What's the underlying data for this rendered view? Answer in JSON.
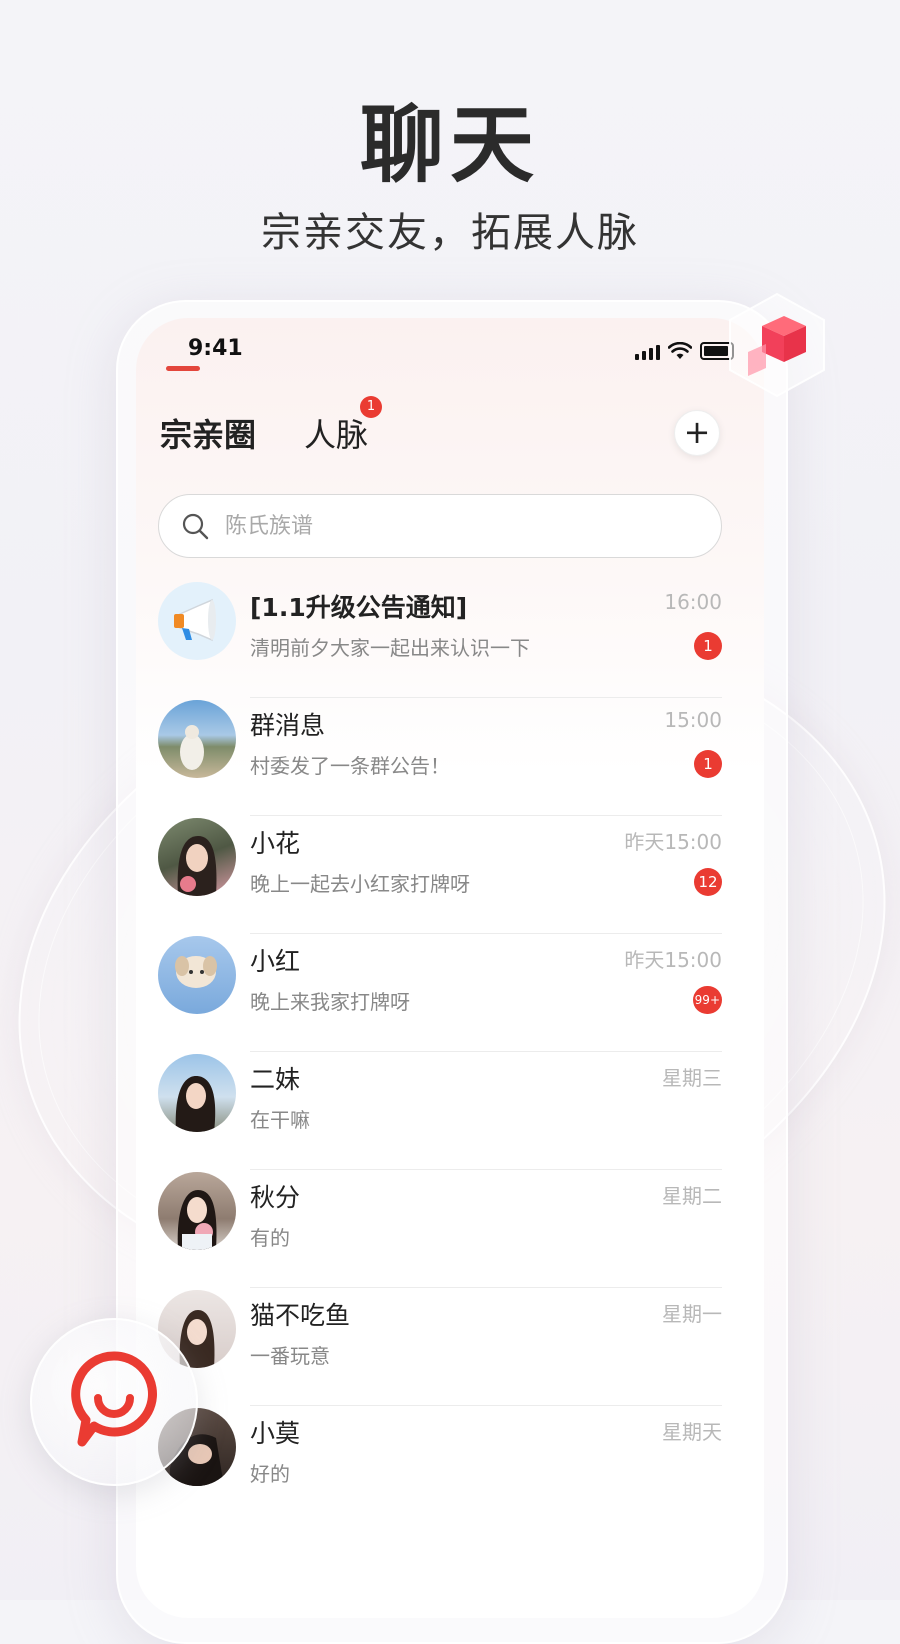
{
  "hero": {
    "title": "聊天",
    "subtitle": "宗亲交友，拓展人脉"
  },
  "status_bar": {
    "time": "9:41"
  },
  "tabs": [
    {
      "label": "宗亲圈",
      "active": true
    },
    {
      "label": "人脉",
      "badge": "1"
    }
  ],
  "add_button": "+",
  "search": {
    "placeholder": "陈氏族谱"
  },
  "chats": [
    {
      "name": "[1.1升级公告通知]",
      "message": "清明前夕大家一起出来认识一下",
      "time": "16:00",
      "unread": "1",
      "avatar": "megaphone-icon"
    },
    {
      "name": "群消息",
      "message": "村委发了一条群公告！",
      "time": "15:00",
      "unread": "1",
      "avatar": "landscape-avatar"
    },
    {
      "name": "小花",
      "message": "晚上一起去小红家打牌呀",
      "time": "昨天15:00",
      "unread": "12",
      "avatar": "woman-avatar"
    },
    {
      "name": "小红",
      "message": "晚上来我家打牌呀",
      "time": "昨天15:00",
      "unread": "99+",
      "avatar": "dog-avatar"
    },
    {
      "name": "二妹",
      "message": "在干嘛",
      "time": "星期三",
      "avatar": "woman-avatar"
    },
    {
      "name": "秋分",
      "message": "有的",
      "time": "星期二",
      "avatar": "woman-flowers-avatar"
    },
    {
      "name": "猫不吃鱼",
      "message": "一番玩意",
      "time": "星期一",
      "avatar": "woman-avatar"
    },
    {
      "name": "小莫",
      "message": "好的",
      "time": "星期天",
      "avatar": "woman-avatar"
    }
  ],
  "colors": {
    "accent": "#e3463c",
    "badge": "#ea3b32"
  }
}
